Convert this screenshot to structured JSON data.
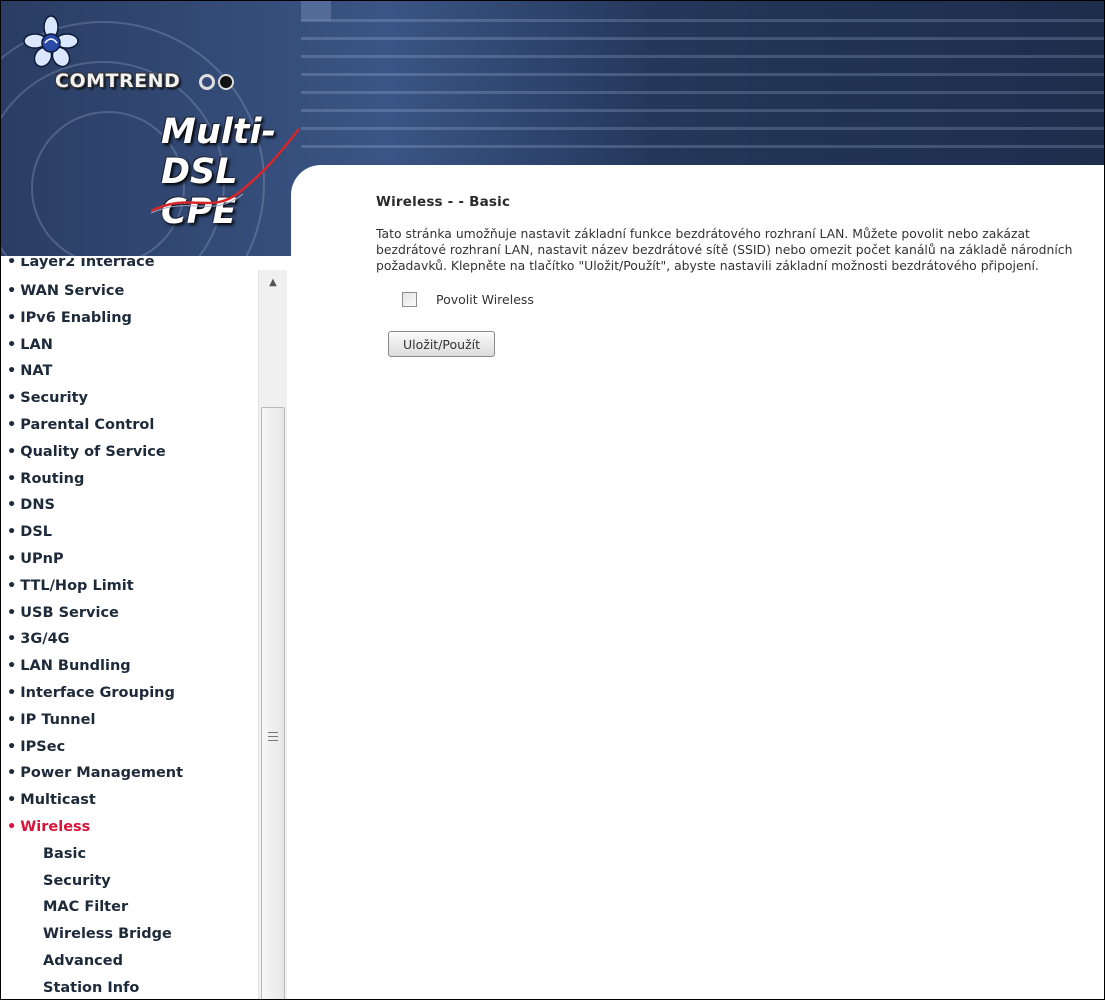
{
  "header": {
    "brand": "COMTREND",
    "product": "Multi-DSL CPE"
  },
  "sidebar": {
    "items": [
      {
        "label": "Layer2 Interface",
        "active": false,
        "cut": true
      },
      {
        "label": "WAN Service",
        "active": false
      },
      {
        "label": "IPv6 Enabling",
        "active": false
      },
      {
        "label": "LAN",
        "active": false
      },
      {
        "label": "NAT",
        "active": false
      },
      {
        "label": "Security",
        "active": false
      },
      {
        "label": "Parental Control",
        "active": false
      },
      {
        "label": "Quality of Service",
        "active": false
      },
      {
        "label": "Routing",
        "active": false
      },
      {
        "label": "DNS",
        "active": false
      },
      {
        "label": "DSL",
        "active": false
      },
      {
        "label": "UPnP",
        "active": false
      },
      {
        "label": "TTL/Hop Limit",
        "active": false
      },
      {
        "label": "USB Service",
        "active": false
      },
      {
        "label": "3G/4G",
        "active": false
      },
      {
        "label": "LAN Bundling",
        "active": false
      },
      {
        "label": "Interface Grouping",
        "active": false
      },
      {
        "label": "IP Tunnel",
        "active": false
      },
      {
        "label": "IPSec",
        "active": false
      },
      {
        "label": "Power Management",
        "active": false
      },
      {
        "label": "Multicast",
        "active": false
      },
      {
        "label": "Wireless",
        "active": true
      }
    ],
    "subitems": [
      "Basic",
      "Security",
      "MAC Filter",
      "Wireless Bridge",
      "Advanced",
      "Station Info"
    ],
    "active_color": "#d8143a"
  },
  "main": {
    "title": "Wireless - - Basic",
    "description": "Tato stránka umožňuje nastavit základní funkce bezdrátového rozhraní LAN. Můžete povolit nebo zakázat bezdrátové rozhraní LAN, nastavit název bezdrátové sítě (SSID) nebo omezit počet kanálů na základě národních požadavků. Klepněte na tlačítko \"Uložit/Použít\", abyste nastavili základní možnosti bezdrátového připojení.",
    "enable_wireless_label": "Povolit Wireless",
    "enable_wireless_checked": false,
    "apply_button": "Uložit/Použít"
  }
}
